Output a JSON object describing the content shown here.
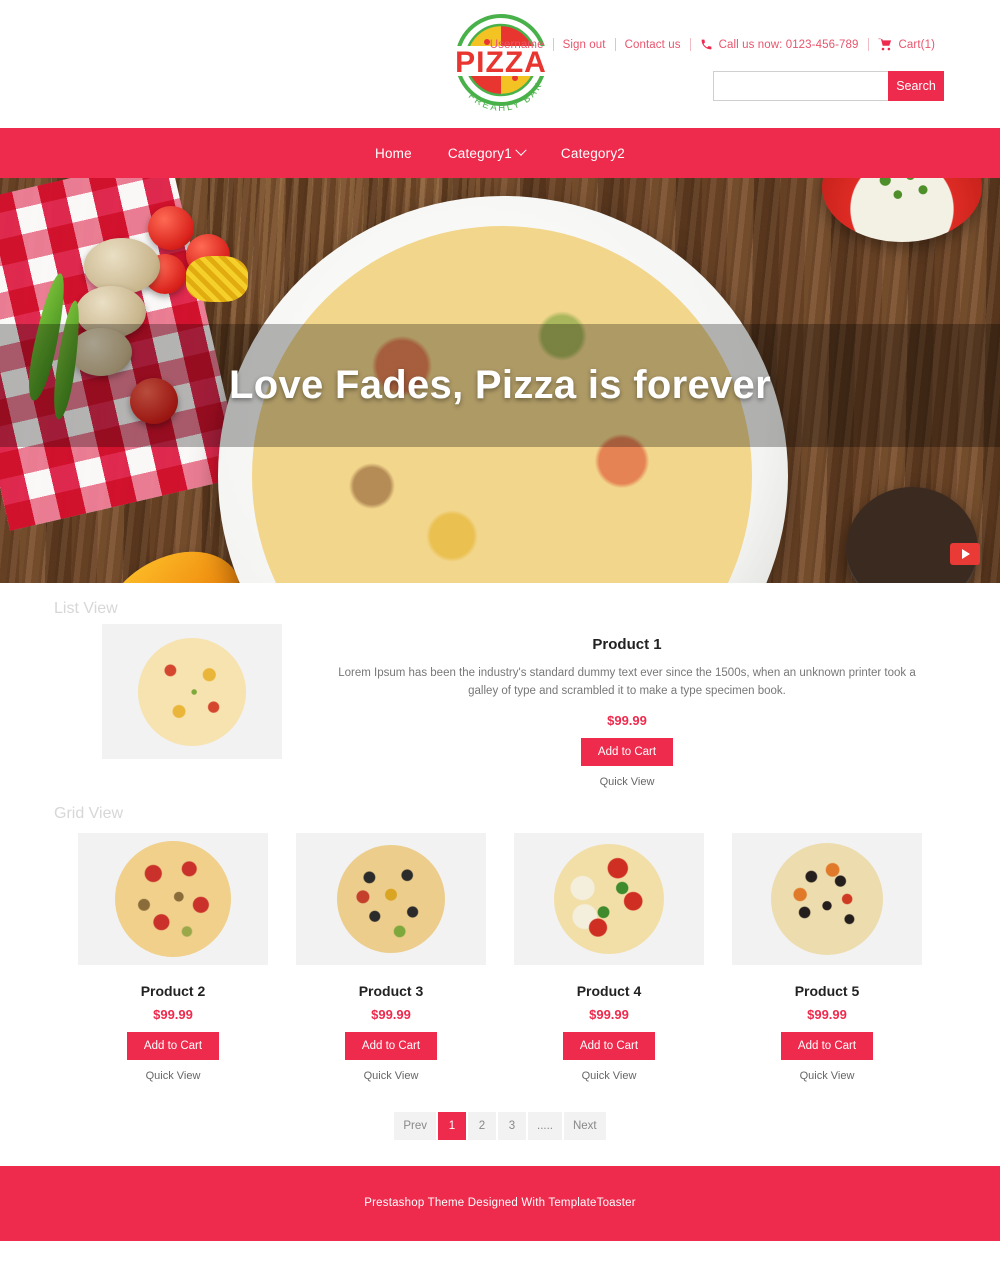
{
  "brand": {
    "name": "PIZZA",
    "tagline": "FREAHLY BAKED"
  },
  "colors": {
    "accent": "#ee2a4d",
    "accent_light": "#e8556d",
    "panel_gray": "#f2f2f2",
    "section_title_gray": "#d7d7d7"
  },
  "header": {
    "links": [
      {
        "label": "Username",
        "icon": ""
      },
      {
        "label": "Sign out",
        "icon": ""
      },
      {
        "label": "Contact us",
        "icon": ""
      },
      {
        "label": "Call us now: 0123-456-789",
        "icon": "phone-icon"
      },
      {
        "label": "Cart(1)",
        "icon": "cart-icon"
      }
    ],
    "search": {
      "value": "",
      "placeholder": "",
      "button_label": "Search"
    }
  },
  "nav": {
    "items": [
      {
        "label": "Home",
        "has_dropdown": false
      },
      {
        "label": "Category1",
        "has_dropdown": true
      },
      {
        "label": "Category2",
        "has_dropdown": false
      }
    ]
  },
  "hero": {
    "caption": "Love Fades, Pizza is forever",
    "play_button_icon": "play-icon"
  },
  "sections": {
    "list_view_title": "List View",
    "grid_view_title": "Grid View"
  },
  "list_product": {
    "name": "Product 1",
    "description": "Lorem Ipsum has been the industry's standard dummy text ever since the 1500s, when an unknown printer took a galley of type and scrambled it to make a type specimen book.",
    "price": "$99.99",
    "add_to_cart_label": "Add to Cart",
    "quick_view_label": "Quick View"
  },
  "grid_products": [
    {
      "name": "Product 2",
      "price": "$99.99",
      "add_to_cart_label": "Add to Cart",
      "quick_view_label": "Quick View"
    },
    {
      "name": "Product 3",
      "price": "$99.99",
      "add_to_cart_label": "Add to Cart",
      "quick_view_label": "Quick View"
    },
    {
      "name": "Product 4",
      "price": "$99.99",
      "add_to_cart_label": "Add to Cart",
      "quick_view_label": "Quick View"
    },
    {
      "name": "Product 5",
      "price": "$99.99",
      "add_to_cart_label": "Add to Cart",
      "quick_view_label": "Quick View"
    }
  ],
  "pagination": {
    "items": [
      {
        "label": "Prev",
        "active": false
      },
      {
        "label": "1",
        "active": true
      },
      {
        "label": "2",
        "active": false
      },
      {
        "label": "3",
        "active": false
      },
      {
        "label": ".....",
        "active": false
      },
      {
        "label": "Next",
        "active": false
      }
    ]
  },
  "footer": {
    "text": "Prestashop Theme Designed With TemplateToaster"
  }
}
